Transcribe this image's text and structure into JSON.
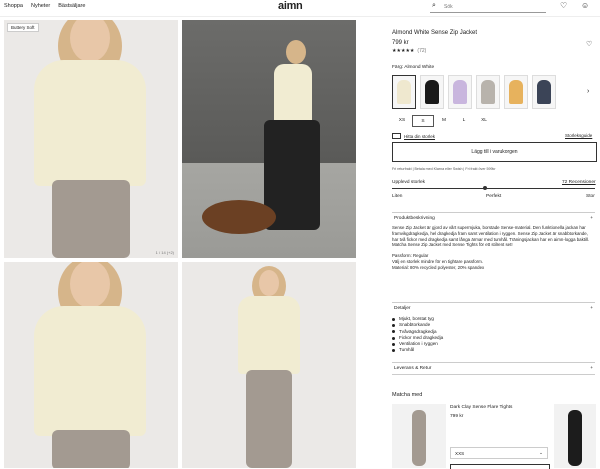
{
  "nav": {
    "items": [
      "Shoppa",
      "Nyheter",
      "Bästsäljare"
    ],
    "logo": "aimn"
  },
  "search": {
    "placeholder": "Sök"
  },
  "icons": {
    "search": "search-icon",
    "wishlist": "heart-icon",
    "account": "user-icon",
    "next": "chevron-right-icon",
    "plus": "plus-icon",
    "minus": "minus-icon"
  },
  "gallery": {
    "badge": "Buttery Soft",
    "counter": "1 / 14 (+2)"
  },
  "product": {
    "title": "Almond White Sense Zip Jacket",
    "price": "799 kr",
    "stars": "★★★★★",
    "review_count": "(72)",
    "color_label": "Färg: Almond White",
    "swatch_colors": [
      "#efe8cf",
      "#1a1a1a",
      "#c9b6de",
      "#b8b3ac",
      "#e7b25d",
      "#3b4457"
    ],
    "sizes": [
      "XS",
      "S",
      "M",
      "L",
      "XL"
    ],
    "selected_size": "S",
    "find_size": "Hitta din storlek",
    "size_guide": "Storleksguide",
    "add_to_cart": "Lägg till i varukorgen",
    "shipping": "Fri returfrakt | Betala med Klarna eller Swish | Fri frakt över 599kr"
  },
  "fit": {
    "label": "Upplevd storlek",
    "reviews": "72 Recensioner",
    "left": "Liten",
    "mid": "Perfekt",
    "right": "Stor",
    "value": 0.46
  },
  "sections": {
    "description_title": "Produktbeskrivning",
    "description_p1": "Sense Zip Jacket är gjord av vårt supermjuka, borstade Sense-material. Den funktionella jackan har framvikgdragkedja, hel dragkedja fram samt ventilation i ryggen. Sense Zip Jacket är snabbtorkande, har två fickor med dragkedja samt långa ärmar med tumhål. Träningsjackan har en aimn-logga baktill. Matcha Sense Zip Jacket med Sense Tights för ett stilrent set!",
    "description_p2": "Passform: Regular",
    "description_p3": "Välj en storlek mindre för en tightare passform.",
    "description_p4": "Material: 80% recycled polyester, 20% spandex",
    "details_title": "Detaljer",
    "details": [
      "Mjukt, borstat tyg",
      "Snabbtorkande",
      "Tvåvägsdragkedja",
      "Fickor med dragkedja",
      "Ventilation i ryggen",
      "Tumhål"
    ],
    "shipping_title": "Leverans & Retur"
  },
  "match": {
    "title": "Matcha med",
    "name": "Dark Clay Sense Flare Tights",
    "price": "799 kr",
    "size": "XXS"
  }
}
